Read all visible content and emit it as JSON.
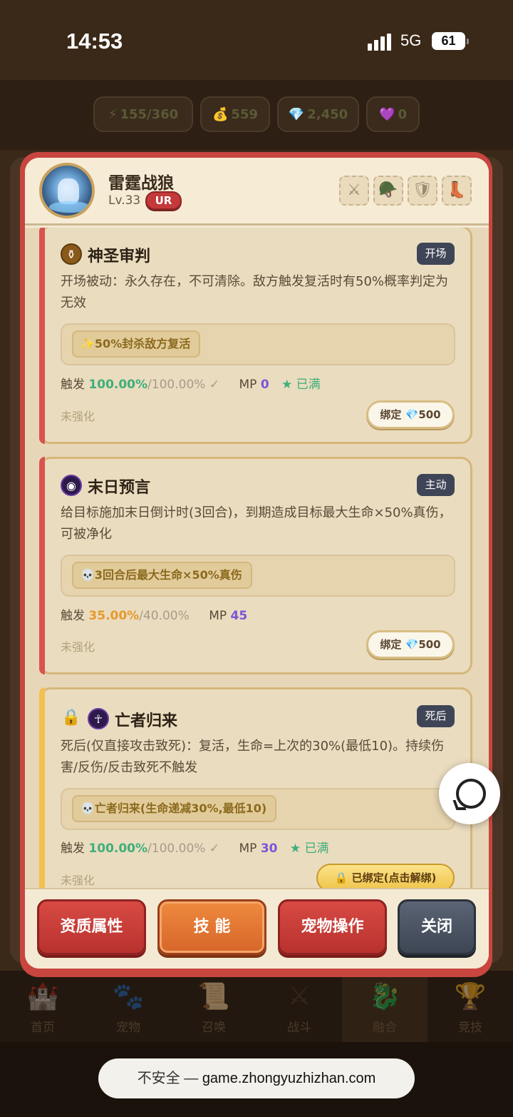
{
  "status_bar": {
    "time": "14:53",
    "network": "5G",
    "battery": "61"
  },
  "resources": [
    {
      "icon": "⚡",
      "value": "155/360"
    },
    {
      "icon": "💰",
      "value": "559"
    },
    {
      "icon": "💎",
      "value": "2,450"
    },
    {
      "icon": "💜",
      "value": "0"
    }
  ],
  "pet": {
    "name": "雷霆战狼",
    "level": "Lv.33",
    "rarity": "UR"
  },
  "equip_slots": [
    "⚔",
    "🪖",
    "🛡",
    "👢"
  ],
  "skills": [
    {
      "name": "神圣审判",
      "tag": "开场",
      "description": "开场被动：永久存在，不可清除。敌方触发复活时有50%概率判定为无效",
      "effect": "✨50%封杀敌方复活",
      "trigger_label": "触发",
      "trigger_value": "100.00%",
      "trigger_max": "/100.00%",
      "check": "✓",
      "mp_label": "MP",
      "mp": "0",
      "full": "★ 已满",
      "enhance": "未强化",
      "bind_label": "绑定",
      "bind_cost": "500",
      "bar_color": "#d9534f"
    },
    {
      "name": "末日预言",
      "tag": "主动",
      "description": "给目标施加末日倒计时(3回合)，到期造成目标最大生命×50%真伤，可被净化",
      "effect": "💀3回合后最大生命×50%真伤",
      "trigger_label": "触发",
      "trigger_value": "35.00%",
      "trigger_max": "/40.00%",
      "mp_label": "MP",
      "mp": "45",
      "enhance": "未强化",
      "bind_label": "绑定",
      "bind_cost": "500",
      "bar_color": "#d9534f"
    },
    {
      "name": "亡者归来",
      "tag": "死后",
      "description": "死后(仅直接攻击致死)：复活，生命=上次的30%(最低10)。持续伤害/反伤/反击致死不触发",
      "effect": "💀亡者归来(生命递减30%,最低10)",
      "trigger_label": "触发",
      "trigger_value": "100.00%",
      "trigger_max": "/100.00%",
      "check": "✓",
      "mp_label": "MP",
      "mp": "30",
      "full": "★ 已满",
      "enhance": "未强化",
      "bound_label": "已绑定(点击解绑)",
      "bar_color": "#f2c14e"
    }
  ],
  "footer_buttons": {
    "attributes": "资质属性",
    "skills": "技 能",
    "pet_ops": "宠物操作",
    "close": "关闭"
  },
  "bottom_nav": [
    "首页",
    "宠物",
    "召唤",
    "战斗",
    "融合",
    "竞技"
  ],
  "url_bar": {
    "prefix": "不安全 — ",
    "host": "game.zhongyuzhizhan.com"
  }
}
